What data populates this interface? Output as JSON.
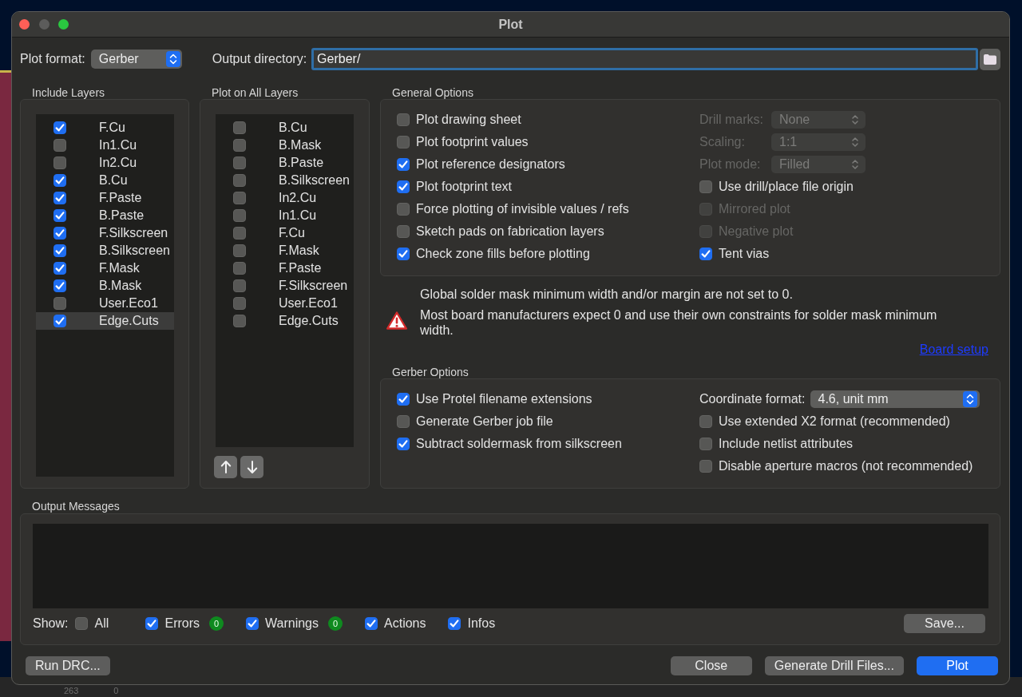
{
  "window": {
    "title": "Plot"
  },
  "plot_format": {
    "label": "Plot format:",
    "value": "Gerber"
  },
  "output_directory": {
    "label": "Output directory:",
    "value": "Gerber/",
    "focused": true
  },
  "include_layers": {
    "title": "Include Layers",
    "layers": [
      {
        "name": "F.Cu",
        "checked": true,
        "selected": false
      },
      {
        "name": "In1.Cu",
        "checked": false,
        "selected": false
      },
      {
        "name": "In2.Cu",
        "checked": false,
        "selected": false
      },
      {
        "name": "B.Cu",
        "checked": true,
        "selected": false
      },
      {
        "name": "F.Paste",
        "checked": true,
        "selected": false
      },
      {
        "name": "B.Paste",
        "checked": true,
        "selected": false
      },
      {
        "name": "F.Silkscreen",
        "checked": true,
        "selected": false
      },
      {
        "name": "B.Silkscreen",
        "checked": true,
        "selected": false
      },
      {
        "name": "F.Mask",
        "checked": true,
        "selected": false
      },
      {
        "name": "B.Mask",
        "checked": true,
        "selected": false
      },
      {
        "name": "User.Eco1",
        "checked": false,
        "selected": false
      },
      {
        "name": "Edge.Cuts",
        "checked": true,
        "selected": true
      }
    ]
  },
  "plot_on_all_layers": {
    "title": "Plot on All Layers",
    "layers": [
      {
        "name": "B.Cu",
        "checked": false
      },
      {
        "name": "B.Mask",
        "checked": false
      },
      {
        "name": "B.Paste",
        "checked": false
      },
      {
        "name": "B.Silkscreen",
        "checked": false
      },
      {
        "name": "In2.Cu",
        "checked": false
      },
      {
        "name": "In1.Cu",
        "checked": false
      },
      {
        "name": "F.Cu",
        "checked": false
      },
      {
        "name": "F.Mask",
        "checked": false
      },
      {
        "name": "F.Paste",
        "checked": false
      },
      {
        "name": "F.Silkscreen",
        "checked": false
      },
      {
        "name": "User.Eco1",
        "checked": false
      },
      {
        "name": "Edge.Cuts",
        "checked": false
      }
    ]
  },
  "general_options": {
    "title": "General Options",
    "options": [
      {
        "label": "Plot drawing sheet",
        "checked": false
      },
      {
        "label": "Plot footprint values",
        "checked": false
      },
      {
        "label": "Plot reference designators",
        "checked": true
      },
      {
        "label": "Plot footprint text",
        "checked": true
      },
      {
        "label": "Force plotting of invisible values / refs",
        "checked": false
      },
      {
        "label": "Sketch pads on fabrication layers",
        "checked": false
      },
      {
        "label": "Check zone fills before plotting",
        "checked": true
      }
    ],
    "settings": [
      {
        "kind": "dropdown",
        "label": "Drill marks:",
        "value": "None",
        "disabled": true
      },
      {
        "kind": "dropdown",
        "label": "Scaling:",
        "value": "1:1",
        "disabled": true
      },
      {
        "kind": "dropdown",
        "label": "Plot mode:",
        "value": "Filled",
        "disabled": true
      },
      {
        "kind": "checkbox",
        "label": "Use drill/place file origin",
        "checked": false,
        "disabled": false
      },
      {
        "kind": "checkbox",
        "label": "Mirrored plot",
        "checked": false,
        "disabled": true
      },
      {
        "kind": "checkbox",
        "label": "Negative plot",
        "checked": false,
        "disabled": true
      },
      {
        "kind": "checkbox",
        "label": "Tent vias",
        "checked": true,
        "disabled": false
      }
    ]
  },
  "warning": {
    "lines": [
      "Global solder mask minimum width and/or margin are not set to 0.",
      "Most board manufacturers expect 0 and use their own constraints for solder mask minimum width."
    ],
    "link": "Board setup"
  },
  "gerber_options": {
    "title": "Gerber Options",
    "options": [
      {
        "label": "Use Protel filename extensions",
        "checked": true
      },
      {
        "label": "Generate Gerber job file",
        "checked": false
      },
      {
        "label": "Subtract soldermask from silkscreen",
        "checked": true
      }
    ],
    "settings": [
      {
        "kind": "dropdown",
        "label": "Coordinate format:",
        "value": "4.6, unit mm",
        "disabled": false
      },
      {
        "kind": "checkbox",
        "label": "Use extended X2 format (recommended)",
        "checked": false,
        "disabled": false
      },
      {
        "kind": "checkbox",
        "label": "Include netlist attributes",
        "checked": false,
        "disabled": false
      },
      {
        "kind": "checkbox",
        "label": "Disable aperture macros (not recommended)",
        "checked": false,
        "disabled": false
      }
    ]
  },
  "output_messages": {
    "title": "Output Messages",
    "show_label": "Show:",
    "filters": [
      {
        "label": "All",
        "checked": false
      },
      {
        "label": "Errors",
        "checked": true,
        "count": "0"
      },
      {
        "label": "Warnings",
        "checked": true,
        "count": "0"
      },
      {
        "label": "Actions",
        "checked": true
      },
      {
        "label": "Infos",
        "checked": true
      }
    ],
    "save_button": "Save..."
  },
  "footer": {
    "left_buttons": [
      {
        "label": "Run DRC...",
        "kind": "default"
      }
    ],
    "right_buttons": [
      {
        "label": "Close",
        "kind": "default"
      },
      {
        "label": "Generate Drill Files...",
        "kind": "default"
      },
      {
        "label": "Plot",
        "kind": "primary"
      }
    ]
  },
  "background": {
    "status_texts": [
      "263",
      "0"
    ]
  }
}
